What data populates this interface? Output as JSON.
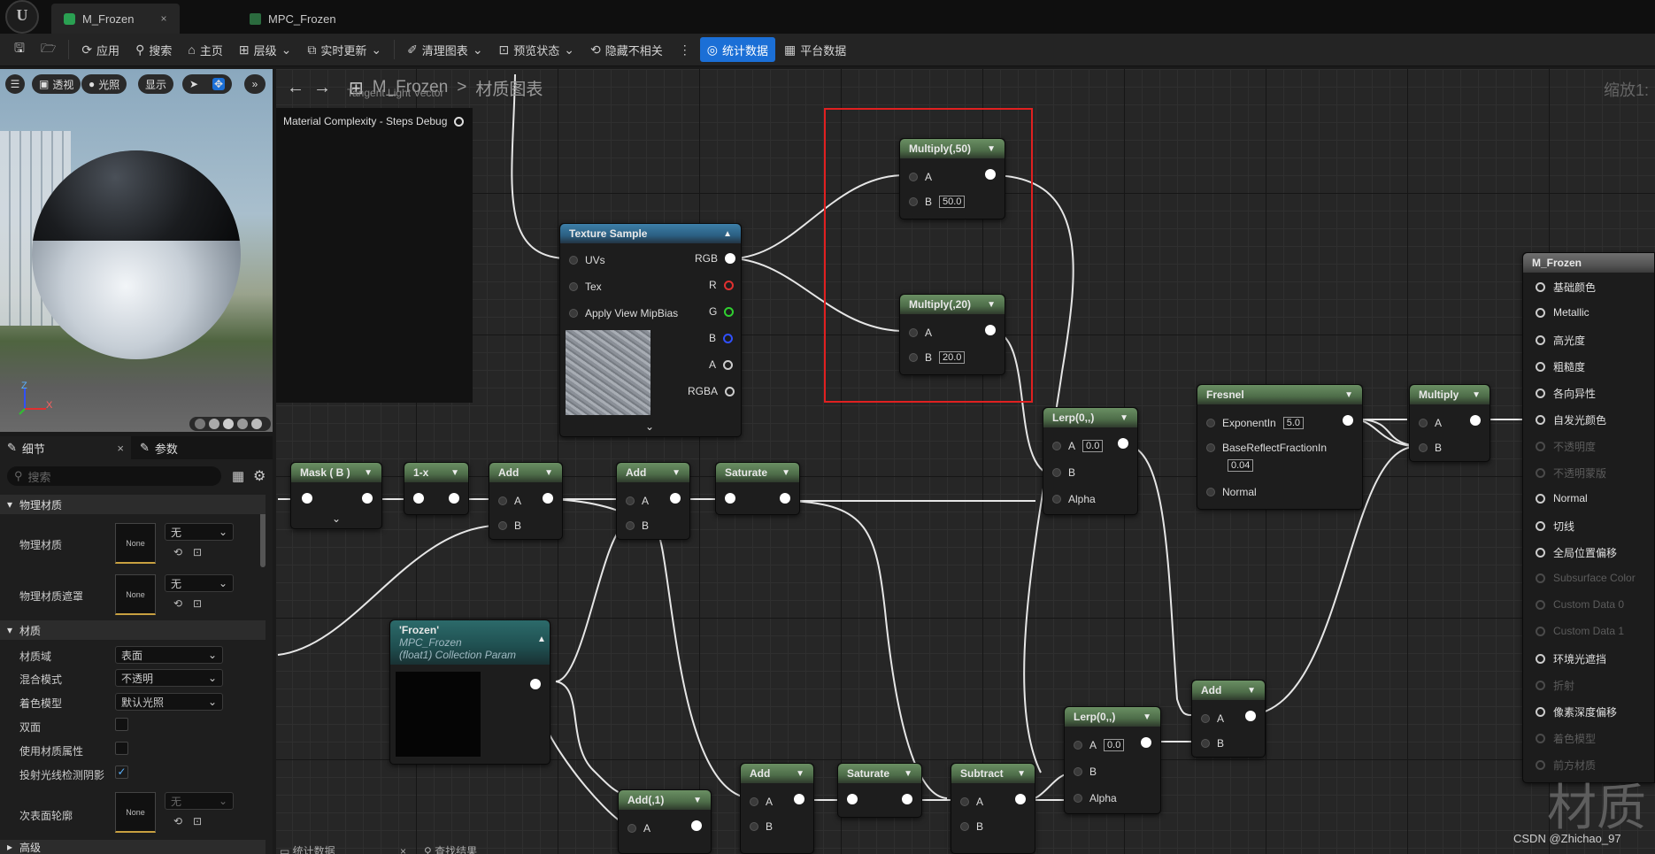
{
  "tabs": [
    {
      "label": "M_Frozen",
      "close": "×"
    },
    {
      "label": "MPC_Frozen"
    }
  ],
  "toolbar": {
    "apply": "应用",
    "search": "搜索",
    "home": "主页",
    "hierarchy": "层级",
    "live_update": "实时更新",
    "clean_graph": "清理图表",
    "preview_state": "预览状态",
    "hide_unrelated": "隐藏不相关",
    "stats": "统计数据",
    "platform_stats": "平台数据"
  },
  "viewport": {
    "perspective": "透视",
    "lit": "光照",
    "show": "显示",
    "axis_z": "Z",
    "axis_x": "X"
  },
  "details": {
    "tab_details": "细节",
    "tab_params": "参数",
    "tab_close": "×",
    "search_placeholder": "搜索",
    "sec_phys": "物理材质",
    "phys_material": "物理材质",
    "phys_material_mask": "物理材质遮罩",
    "none_thumb": "None",
    "none_drop": "无",
    "sec_material": "材质",
    "material_domain": "材质域",
    "material_domain_val": "表面",
    "blend_mode": "混合模式",
    "blend_mode_val": "不透明",
    "shading_model": "着色模型",
    "shading_model_val": "默认光照",
    "two_sided": "双面",
    "use_material_attrs": "使用材质属性",
    "cast_ray_shadow": "投射光线检测阴影",
    "subsurface_profile": "次表面轮廓",
    "advanced": "高级"
  },
  "graph": {
    "breadcrumb_root": "M_Frozen",
    "breadcrumb_sep": ">",
    "breadcrumb_page": "材质图表",
    "zoom": "缩放1:",
    "top_ghost": "Tangent Light Vector",
    "steps_debug": "Material Complexity - Steps Debug",
    "watermark": "材质",
    "credit": "CSDN @Zhichao_97",
    "status_stats": "统计数据",
    "status_find": "查找结果"
  },
  "nodes": {
    "multiply50": {
      "title": "Multiply(,50)",
      "a": "A",
      "b": "B",
      "b_val": "50.0"
    },
    "multiply20": {
      "title": "Multiply(,20)",
      "a": "A",
      "b": "B",
      "b_val": "20.0"
    },
    "texture": {
      "title": "Texture Sample",
      "uvs": "UVs",
      "tex": "Tex",
      "mip": "Apply View MipBias",
      "rgb": "RGB",
      "r": "R",
      "g": "G",
      "b": "B",
      "a": "A",
      "rgba": "RGBA"
    },
    "mask": {
      "title": "Mask ( B )"
    },
    "oneminus": {
      "title": "1-x"
    },
    "add1": {
      "title": "Add",
      "a": "A",
      "b": "B"
    },
    "add2": {
      "title": "Add",
      "a": "A",
      "b": "B"
    },
    "saturate1": {
      "title": "Saturate"
    },
    "lerp1": {
      "title": "Lerp(0,,)",
      "a": "A",
      "a_val": "0.0",
      "b": "B",
      "alpha": "Alpha"
    },
    "fresnel": {
      "title": "Fresnel",
      "exp": "ExponentIn",
      "exp_val": "5.0",
      "base": "BaseReflectFractionIn",
      "base_val": "0.04",
      "normal": "Normal"
    },
    "multiply": {
      "title": "Multiply",
      "a": "A",
      "b": "B"
    },
    "frozen_param": {
      "title": "'Frozen'",
      "sub1": "MPC_Frozen",
      "sub2": "(float1) Collection Param"
    },
    "add_1": {
      "title": "Add(,1)",
      "a": "A"
    },
    "add3": {
      "title": "Add",
      "a": "A",
      "b": "B"
    },
    "saturate2": {
      "title": "Saturate"
    },
    "subtract": {
      "title": "Subtract",
      "a": "A",
      "b": "B"
    },
    "lerp2": {
      "title": "Lerp(0,,)",
      "a": "A",
      "a_val": "0.0",
      "b": "B",
      "alpha": "Alpha"
    },
    "add4": {
      "title": "Add",
      "a": "A",
      "b": "B"
    }
  },
  "material_node": {
    "title": "M_Frozen",
    "inputs": [
      {
        "label": "基础颜色",
        "active": true
      },
      {
        "label": "Metallic",
        "active": true
      },
      {
        "label": "高光度",
        "active": true
      },
      {
        "label": "粗糙度",
        "active": true
      },
      {
        "label": "各向异性",
        "active": true
      },
      {
        "label": "自发光颜色",
        "active": true
      },
      {
        "label": "不透明度",
        "active": false
      },
      {
        "label": "不透明蒙版",
        "active": false
      },
      {
        "label": "Normal",
        "active": true
      },
      {
        "label": "切线",
        "active": true
      },
      {
        "label": "全局位置偏移",
        "active": true
      },
      {
        "label": "Subsurface Color",
        "active": false
      },
      {
        "label": "Custom Data 0",
        "active": false
      },
      {
        "label": "Custom Data 1",
        "active": false
      },
      {
        "label": "环境光遮挡",
        "active": true
      },
      {
        "label": "折射",
        "active": false
      },
      {
        "label": "像素深度偏移",
        "active": true
      },
      {
        "label": "着色模型",
        "active": false
      },
      {
        "label": "前方材质",
        "active": false
      }
    ]
  },
  "colors": {
    "accent": "#1b6fd6",
    "highlight_box": "#e02020",
    "node_header": "#5a7d54",
    "texture_header": "#2b6a94"
  }
}
